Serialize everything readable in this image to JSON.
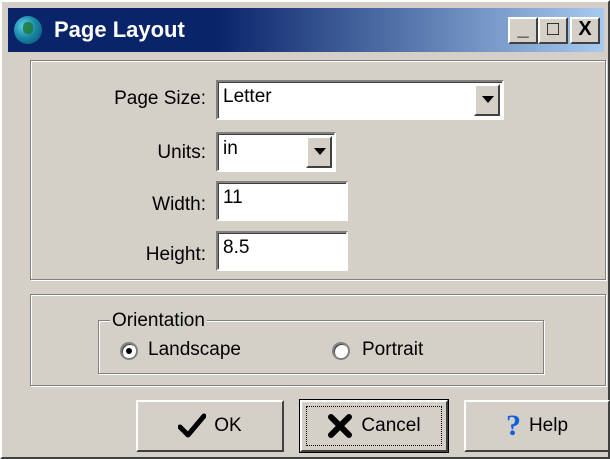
{
  "window": {
    "title": "Page Layout",
    "minimize_label": "_",
    "maximize_label": "□",
    "close_label": "X"
  },
  "form": {
    "page_size_label": "Page Size:",
    "page_size_value": "Letter",
    "units_label": "Units:",
    "units_value": "in",
    "width_label": "Width:",
    "width_value": "11",
    "height_label": "Height:",
    "height_value": "8.5"
  },
  "orientation": {
    "legend": "Orientation",
    "landscape_label": "Landscape",
    "portrait_label": "Portrait",
    "selected": "Landscape"
  },
  "buttons": {
    "ok_label": "OK",
    "cancel_label": "Cancel",
    "help_label": "Help"
  },
  "colors": {
    "titlebar_start": "#0a246a",
    "titlebar_end": "#a6caf0",
    "face": "#d4d0c8",
    "ok_check": "#000000",
    "cancel_x": "#000000",
    "help_question": "#1060e0"
  },
  "icons": {
    "app": "globe-icon",
    "ok": "checkmark-icon",
    "cancel": "x-icon",
    "help": "question-mark-icon"
  }
}
